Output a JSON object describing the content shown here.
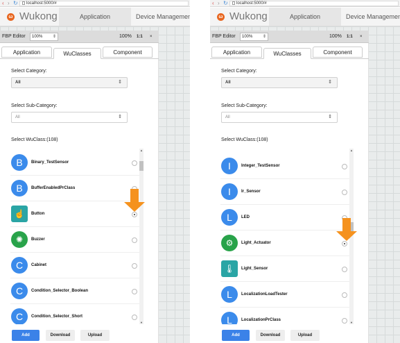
{
  "browser": {
    "url": "localhost:5000/#"
  },
  "app": {
    "brand": "Wukong",
    "nav": [
      "Application Management",
      "Device Management"
    ]
  },
  "toolbar": {
    "title": "FBP Editor",
    "zoom_select": "100%",
    "zoom_pct": "100%",
    "ratio": "1:1",
    "close": "×"
  },
  "tabs": [
    "Application",
    "WuClasses",
    "Component"
  ],
  "form": {
    "category_label": "Select Category:",
    "category_value": "All",
    "subcategory_label": "Select Sub-Category:",
    "subcategory_value": "All",
    "wuclass_label": "Select WuClass:(108)"
  },
  "buttons": {
    "add": "Add",
    "download": "Download",
    "upload": "Upload"
  },
  "left_list": [
    {
      "letter": "B",
      "name": "Binary_TestSensor",
      "icon": "letter-circle",
      "checked": false
    },
    {
      "letter": "B",
      "name": "BufferEnabledPrClass",
      "icon": "letter-circle",
      "checked": false
    },
    {
      "letter": "☝",
      "name": "Button",
      "icon": "button-icon",
      "checked": true
    },
    {
      "letter": "✺",
      "name": "Buzzer",
      "icon": "buzzer-icon",
      "checked": false
    },
    {
      "letter": "C",
      "name": "Cabinet",
      "icon": "letter-circle",
      "checked": false
    },
    {
      "letter": "C",
      "name": "Condition_Selector_Boolean",
      "icon": "letter-circle",
      "checked": false
    },
    {
      "letter": "C",
      "name": "Condition_Selector_Short",
      "icon": "letter-circle",
      "checked": false
    }
  ],
  "right_list": [
    {
      "letter": "I",
      "name": "Integer_TestSensor",
      "icon": "letter-circle",
      "checked": false
    },
    {
      "letter": "I",
      "name": "Ir_Sensor",
      "icon": "letter-circle",
      "checked": false
    },
    {
      "letter": "L",
      "name": "LED",
      "icon": "letter-circle",
      "checked": false
    },
    {
      "letter": "⚙",
      "name": "Light_Actuator",
      "icon": "light-actuator-icon",
      "checked": true
    },
    {
      "letter": "🌡",
      "name": "Light_Sensor",
      "icon": "light-sensor-icon",
      "checked": false
    },
    {
      "letter": "L",
      "name": "LocalizationLoadTester",
      "icon": "letter-circle",
      "checked": false
    },
    {
      "letter": "L",
      "name": "LocalizationPrClass",
      "icon": "letter-circle",
      "checked": false
    }
  ],
  "colors": {
    "accent": "#3b82e8",
    "arrow": "#f5921e",
    "brand_logo": "#e8661f"
  }
}
